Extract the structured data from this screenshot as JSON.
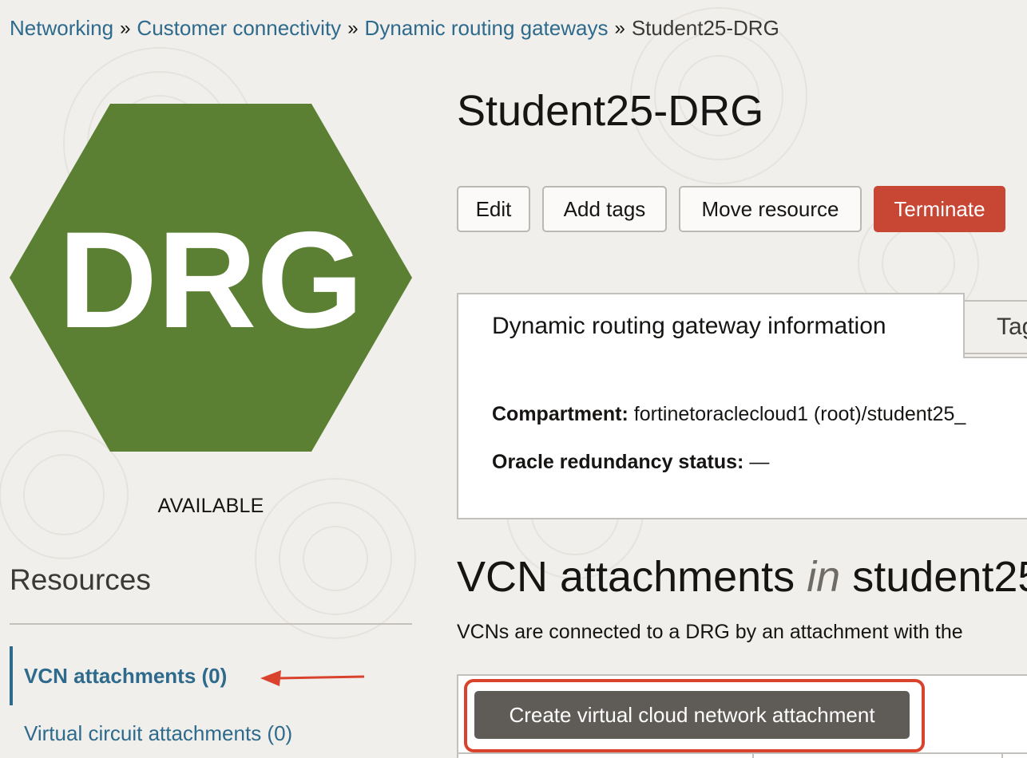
{
  "breadcrumb": {
    "items": [
      "Networking",
      "Customer connectivity",
      "Dynamic routing gateways"
    ],
    "current": "Student25-DRG",
    "separator": "»"
  },
  "resource_icon": {
    "label": "DRG",
    "color": "#5b8033",
    "status": "AVAILABLE"
  },
  "header": {
    "title": "Student25-DRG"
  },
  "actions": {
    "edit": "Edit",
    "add_tags": "Add tags",
    "move_resource": "Move resource",
    "terminate": "Terminate"
  },
  "info_tabs": {
    "active": "Dynamic routing gateway information",
    "inactive": "Tags"
  },
  "info": {
    "compartment_label": "Compartment:",
    "compartment_value": "fortinetoraclecloud1 (root)/student25_",
    "redundancy_label": "Oracle redundancy status:",
    "redundancy_value": "—"
  },
  "resources": {
    "title": "Resources",
    "items": [
      {
        "label": "VCN attachments (0)",
        "active": true
      },
      {
        "label": "Virtual circuit attachments (0)",
        "active": false
      }
    ]
  },
  "attachments": {
    "title_main": "VCN attachments",
    "title_in": "in",
    "title_compartment": "student25",
    "description": "VCNs are connected to a DRG by an attachment with the",
    "create_button": "Create virtual cloud network attachment"
  },
  "colors": {
    "link": "#2d6a8c",
    "danger": "#c74634",
    "annotation": "#d9432d"
  }
}
